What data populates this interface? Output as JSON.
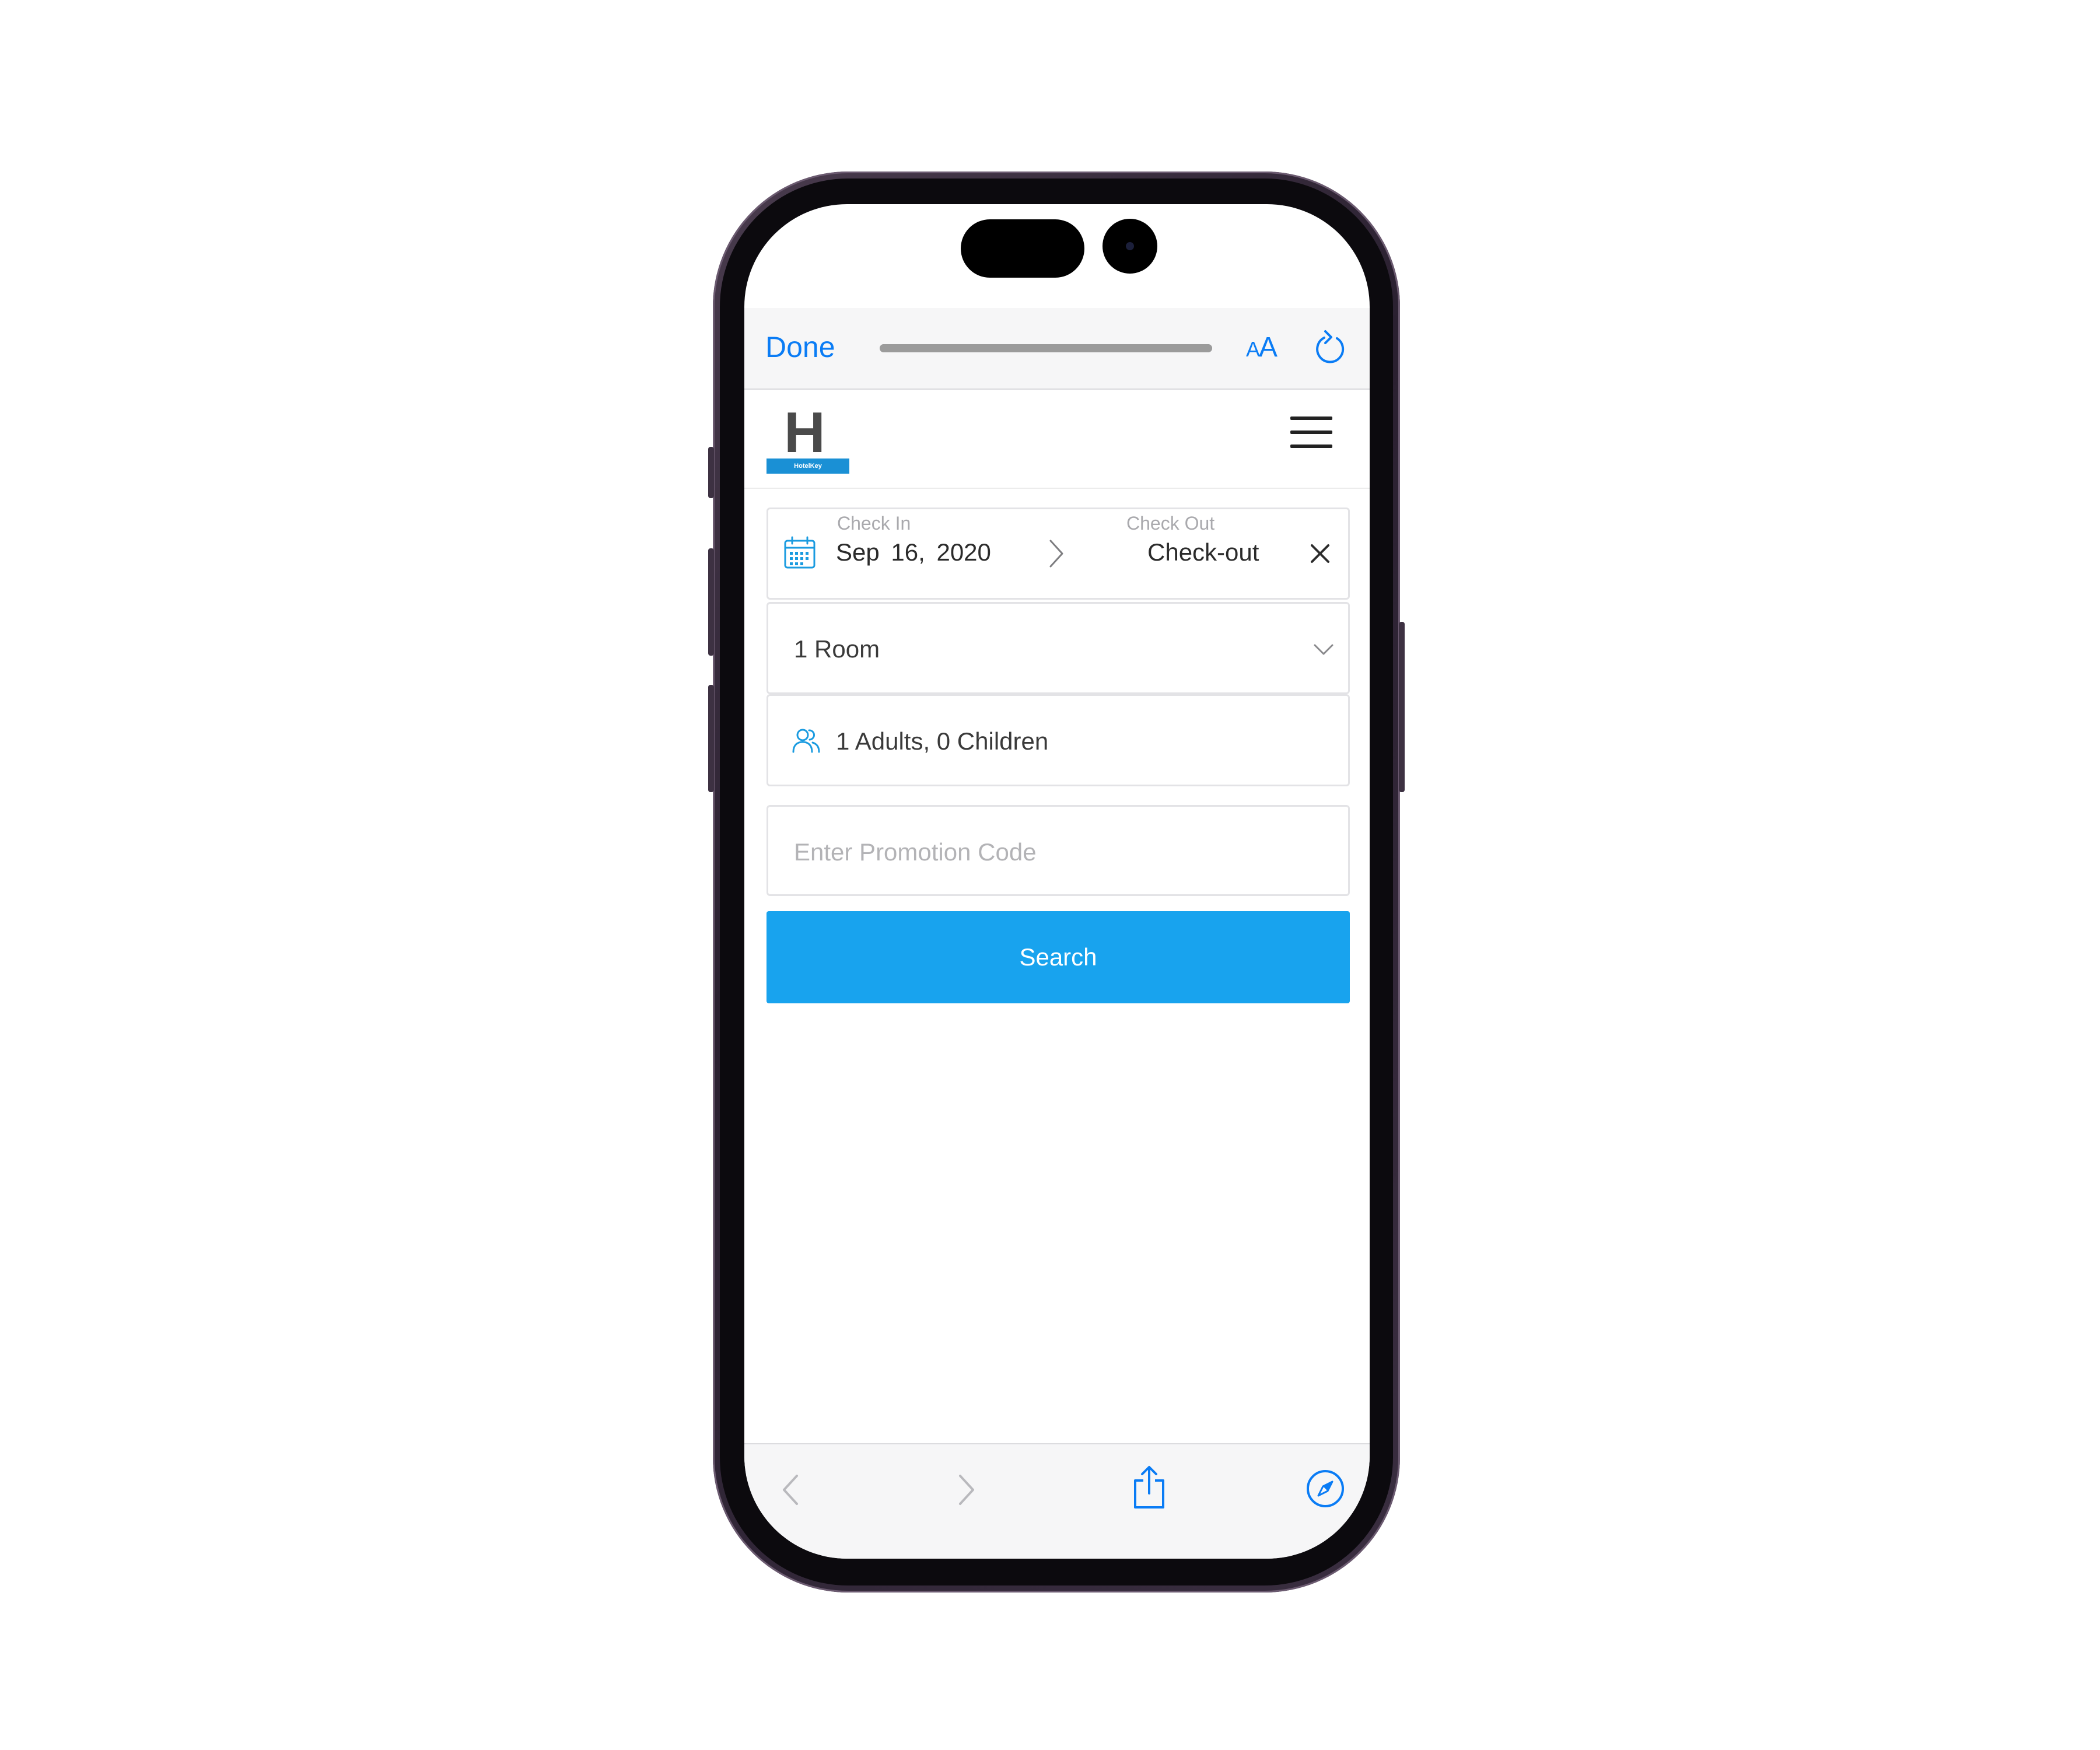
{
  "browser": {
    "done_label": "Done",
    "text_size_small": "A",
    "text_size_large": "A",
    "load_progress": 1.0,
    "accent_color": "#0a7cf5"
  },
  "site": {
    "logo_letter": "H",
    "logo_caption": "HotelKey",
    "brand_color": "#1a90d5"
  },
  "booking": {
    "check_in_label": "Check In",
    "check_in_value": "Sep 16, 2020",
    "check_out_label": "Check Out",
    "check_out_value": "Check-out",
    "rooms_value": "1 Room",
    "guests_value": "1 Adults, 0 Children",
    "promo_placeholder": "Enter Promotion Code",
    "promo_value": "",
    "search_label": "Search",
    "search_color": "#18a3ee"
  },
  "icons": {
    "calendar": "calendar-icon",
    "people": "people-icon",
    "close": "close-icon",
    "chevron_right": "chevron-right-icon",
    "chevron_down": "chevron-down-icon",
    "menu": "hamburger-menu-icon",
    "reload": "reload-icon",
    "back": "back-icon",
    "forward": "forward-icon",
    "share": "share-icon",
    "compass": "compass-icon"
  }
}
